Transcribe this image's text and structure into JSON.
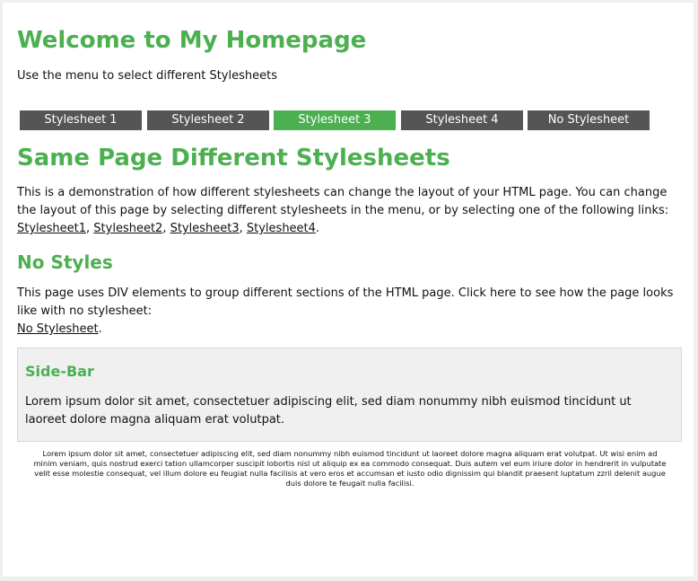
{
  "header": {
    "title": "Welcome to My Homepage",
    "intro": "Use the menu to select different Stylesheets"
  },
  "menu": {
    "items": [
      {
        "label": "Stylesheet 1",
        "active": false
      },
      {
        "label": "Stylesheet 2",
        "active": false
      },
      {
        "label": "Stylesheet 3",
        "active": true
      },
      {
        "label": "Stylesheet 4",
        "active": false
      },
      {
        "label": "No Stylesheet",
        "active": false
      }
    ],
    "colors": {
      "normal": "#555555",
      "active": "#4caf50",
      "text": "#ffffff"
    }
  },
  "main": {
    "title": "Same Page Different Stylesheets",
    "paragraph": "This is a demonstration of how different stylesheets can change the layout of your HTML page. You can change the layout of this page by selecting different stylesheets in the menu, or by selecting one of the following links:",
    "links": [
      "Stylesheet1",
      "Stylesheet2",
      "Stylesheet3",
      "Stylesheet4"
    ],
    "link_separator": ", ",
    "link_end": "."
  },
  "no_styles": {
    "title": "No Styles",
    "paragraph": "This page uses DIV elements to group different sections of the HTML page. Click here to see how the page looks like with no stylesheet:",
    "link": "No Stylesheet",
    "link_end": "."
  },
  "sidebar": {
    "title": "Side-Bar",
    "text": "Lorem ipsum dolor sit amet, consectetuer adipiscing elit, sed diam nonummy nibh euismod tincidunt ut laoreet dolore magna aliquam erat volutpat."
  },
  "footer": {
    "text": "Lorem ipsum dolor sit amet, consectetuer adipiscing elit, sed diam nonummy nibh euismod tincidunt ut laoreet dolore magna aliquam erat volutpat. Ut wisi enim ad minim veniam, quis nostrud exerci tation ullamcorper suscipit lobortis nisl ut aliquip ex ea commodo consequat. Duis autem vel eum iriure dolor in hendrerit in vulputate velit esse molestie consequat, vel illum dolore eu feugiat nulla facilisis at vero eros et accumsan et iusto odio dignissim qui blandit praesent luptatum zzril delenit augue duis dolore te feugait nulla facilisi."
  },
  "theme": {
    "accent": "#4caf50",
    "sidebar_bg": "#f0f0f0",
    "page_bg": "#ffffff"
  }
}
